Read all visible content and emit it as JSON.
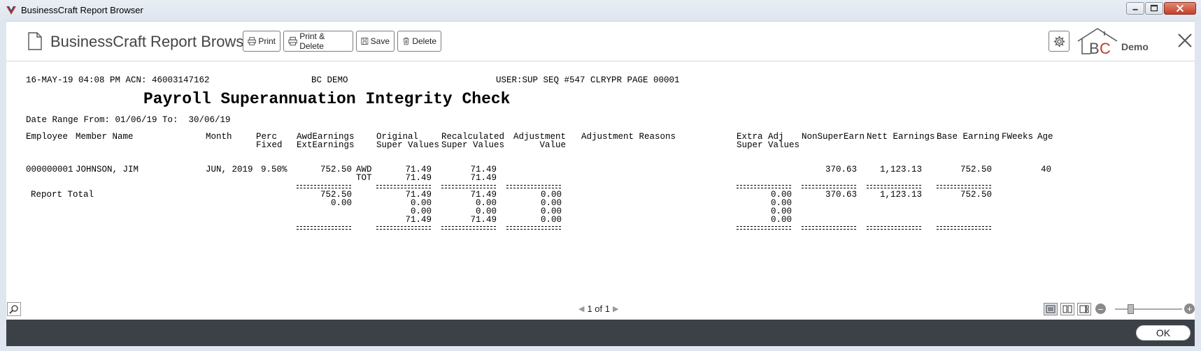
{
  "window": {
    "title": "BusinessCraft Report Browser"
  },
  "header": {
    "app_title": "BusinessCraft Report Browser",
    "buttons": {
      "print": "Print",
      "print_delete": "Print & Delete",
      "save": "Save",
      "delete": "Delete"
    },
    "logo_text": "Demo"
  },
  "report": {
    "line1_left": "16-MAY-19 04:08 PM ACN: 46003147162",
    "line1_mid": "BC DEMO",
    "line1_right": "USER:SUP SEQ #547 CLRYPR PAGE 00001",
    "title": "Payroll Superannuation Integrity Check",
    "date_range": "Date Range From: 01/06/19 To:  30/06/19",
    "headers": {
      "employee": "Employee",
      "member_name": "Member Name",
      "month": "Month",
      "perc1": "Perc",
      "perc2": "Fixed",
      "awd1": "AwdEarnings",
      "awd2": "ExtEarnings",
      "orig1": "Original",
      "orig2": "Super Values",
      "recalc1": "Recalculated",
      "recalc2": "Super Values",
      "adj1": "Adjustment",
      "adj2": "Value",
      "reasons": "Adjustment Reasons",
      "extra1": "Extra Adj",
      "extra2": "Super Values",
      "nonsuper": "NonSuperEarn",
      "nett": "Nett Earnings",
      "base": "Base Earning",
      "fweeks": "FWeeks",
      "age": "Age"
    },
    "row": {
      "employee": "000000001",
      "name": "JOHNSON, JIM",
      "month": "JUN, 2019",
      "perc": "9.50%",
      "awd": "752.50",
      "code1": "AWD",
      "code2": "TOT",
      "orig1": "71.49",
      "orig2": "71.49",
      "recalc1": "71.49",
      "recalc2": "71.49",
      "nonsuper": "370.63",
      "nett": "1,123.13",
      "base": "752.50",
      "age": "40"
    },
    "total_label": "Report Total",
    "totals": {
      "awd": [
        "752.50",
        "0.00"
      ],
      "orig": [
        "71.49",
        "0.00",
        "0.00",
        "71.49"
      ],
      "recalc": [
        "71.49",
        "0.00",
        "0.00",
        "71.49"
      ],
      "adj": [
        "0.00",
        "0.00",
        "0.00",
        "0.00"
      ],
      "extra": [
        "0.00",
        "0.00",
        "0.00",
        "0.00"
      ],
      "nonsuper": "370.63",
      "nett": "1,123.13",
      "base": "752.50"
    }
  },
  "nav": {
    "page_text": "1 of 1"
  },
  "footer": {
    "ok_label": "OK"
  },
  "icons": {
    "app": "bc-app-icon",
    "doc": "document-icon",
    "print": "printer-icon",
    "save": "save-icon",
    "delete": "trash-icon",
    "settings": "gear-icon",
    "close": "close-icon",
    "search": "search-icon"
  },
  "colors": {
    "footer": "#3b4146",
    "logo_red": "#c0392b",
    "titlebar": "#dfe6ef"
  }
}
